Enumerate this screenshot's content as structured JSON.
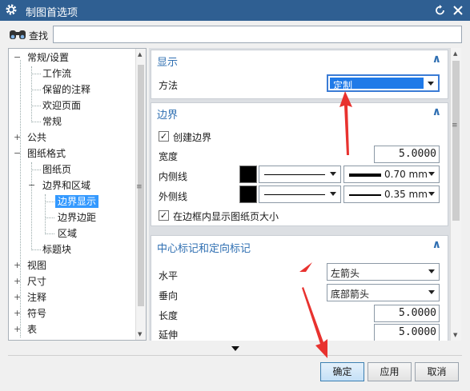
{
  "window": {
    "title": "制图首选项"
  },
  "search": {
    "label": "查找",
    "value": ""
  },
  "tree": {
    "items": [
      {
        "label": "常规/设置",
        "toggle": "−"
      },
      {
        "label": "工作流"
      },
      {
        "label": "保留的注释"
      },
      {
        "label": "欢迎页面"
      },
      {
        "label": "常规"
      },
      {
        "label": "公共",
        "toggle": "+"
      },
      {
        "label": "图纸格式",
        "toggle": "−"
      },
      {
        "label": "图纸页"
      },
      {
        "label": "边界和区域",
        "toggle": "−"
      },
      {
        "label": "边界显示",
        "selected": true
      },
      {
        "label": "边界边距"
      },
      {
        "label": "区域"
      },
      {
        "label": "标题块"
      },
      {
        "label": "视图",
        "toggle": "+"
      },
      {
        "label": "尺寸",
        "toggle": "+"
      },
      {
        "label": "注释",
        "toggle": "+"
      },
      {
        "label": "符号",
        "toggle": "+"
      },
      {
        "label": "表",
        "toggle": "+"
      }
    ]
  },
  "sections": {
    "display": {
      "title": "显示",
      "method_label": "方法",
      "method_value": "定制"
    },
    "border": {
      "title": "边界",
      "create_border_label": "创建边界",
      "create_border_checked": true,
      "width_label": "宽度",
      "width_value": "5.0000",
      "inner_label": "内侧线",
      "inner_thickness": "0.70 mm",
      "outer_label": "外侧线",
      "outer_thickness": "0.35 mm",
      "show_size_label": "在边框内显示图纸页大小",
      "show_size_checked": true
    },
    "center": {
      "title": "中心标记和定向标记",
      "horizontal_label": "水平",
      "horizontal_value": "左箭头",
      "vertical_label": "垂向",
      "vertical_value": "底部箭头",
      "length_label": "长度",
      "length_value": "5.0000",
      "extend_label": "延伸",
      "extend_value": "5.0000"
    }
  },
  "buttons": {
    "ok": "确定",
    "apply": "应用",
    "cancel": "取消"
  },
  "colors": {
    "titlebar": "#2f5f92",
    "accent": "#2f6fb2",
    "selection": "#3399ff",
    "annotation_arrow": "#e8322f"
  }
}
